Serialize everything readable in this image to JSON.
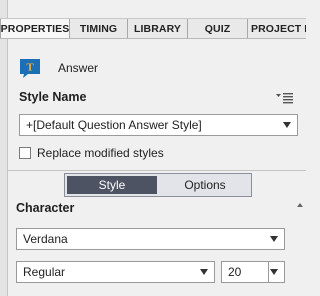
{
  "tabs": [
    {
      "label": "PROPERTIES",
      "active": true
    },
    {
      "label": "TIMING",
      "active": false
    },
    {
      "label": "LIBRARY",
      "active": false
    },
    {
      "label": "QUIZ",
      "active": false
    },
    {
      "label": "PROJECT I...",
      "active": false
    }
  ],
  "header": {
    "label": "Answer",
    "icon": "answer-icon"
  },
  "style_name": {
    "label": "Style Name",
    "selected": "+[Default Question Answer Style]",
    "menu_icon": "panel-menu-icon"
  },
  "replace_styles": {
    "label": "Replace modified styles",
    "checked": false
  },
  "segmented": {
    "style": "Style",
    "options": "Options",
    "active": "Style"
  },
  "character": {
    "label": "Character",
    "font": "Verdana",
    "font_style": "Regular",
    "size": "20"
  },
  "colors": {
    "accent_blue": "#1d6fb5",
    "icon_orange": "#f2b233",
    "segment_active": "#4d5363"
  }
}
